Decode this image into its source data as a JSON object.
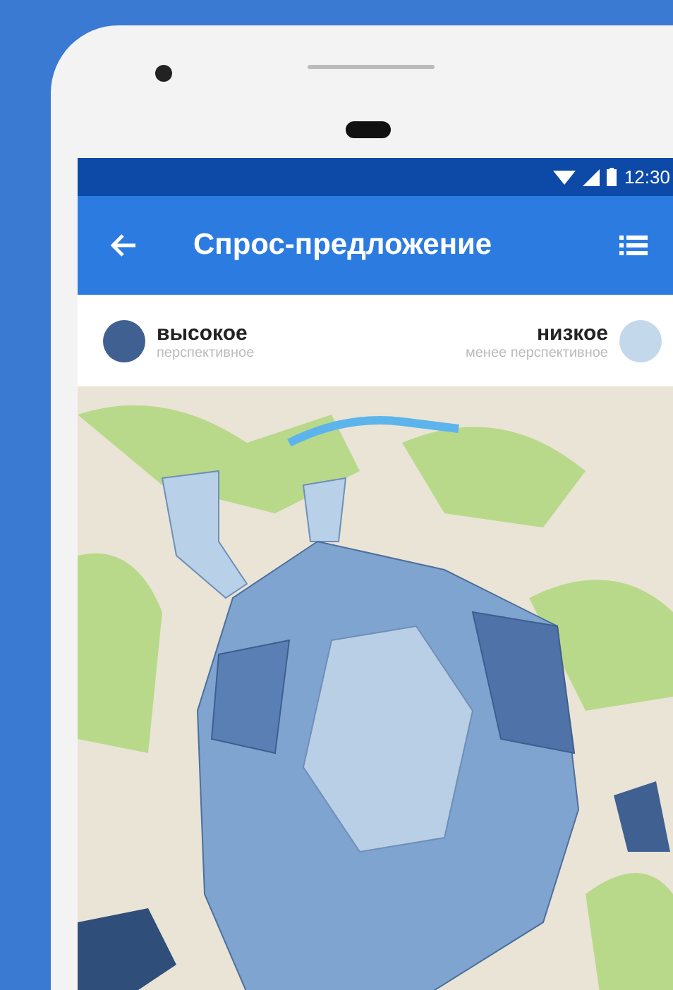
{
  "status_bar": {
    "time": "12:30"
  },
  "app_bar": {
    "title": "Спрос-предложение"
  },
  "legend": [
    {
      "label": "высокое",
      "caption": "перспективное",
      "color": "#3f6090"
    },
    {
      "label": "низкое",
      "caption": "менее перспективное",
      "color": "#c4d8ec"
    }
  ]
}
